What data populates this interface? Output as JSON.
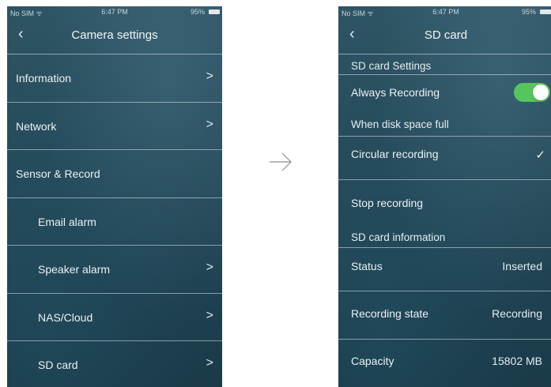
{
  "status_bar": {
    "carrier": "No SIM ᯤ",
    "time": "6:47 PM",
    "battery": "95%"
  },
  "left_screen": {
    "back_icon": "‹",
    "title": "Camera settings",
    "items": [
      {
        "label": "Information",
        "chevron": ">"
      },
      {
        "label": "Network",
        "chevron": ">"
      },
      {
        "label": "Sensor & Record",
        "chevron": ""
      },
      {
        "label": "Email alarm",
        "chevron": ""
      },
      {
        "label": "Speaker alarm",
        "chevron": ">"
      },
      {
        "label": "NAS/Cloud",
        "chevron": ">"
      },
      {
        "label": "SD card",
        "chevron": ">"
      }
    ]
  },
  "flow_arrow": "arrow-right-icon",
  "right_screen": {
    "back_icon": "‹",
    "title": "SD card",
    "sd_settings_header": "SD card Settings",
    "always_recording": {
      "label": "Always Recording",
      "enabled": true
    },
    "disk_full_header": "When disk space full",
    "circular_recording": {
      "label": "Circular recording",
      "check": "✓"
    },
    "stop_recording": {
      "label": "Stop recording"
    },
    "info_header": "SD card information",
    "status": {
      "label": "Status",
      "value": "Inserted"
    },
    "recording_state": {
      "label": "Recording state",
      "value": "Recording"
    },
    "capacity": {
      "label": "Capacity",
      "value": "15802 MB"
    }
  },
  "colors": {
    "background": "#ffffff",
    "screen_top": "#2f5565",
    "screen_bottom": "#1a3a49",
    "toggle_on": "#56c65c"
  }
}
